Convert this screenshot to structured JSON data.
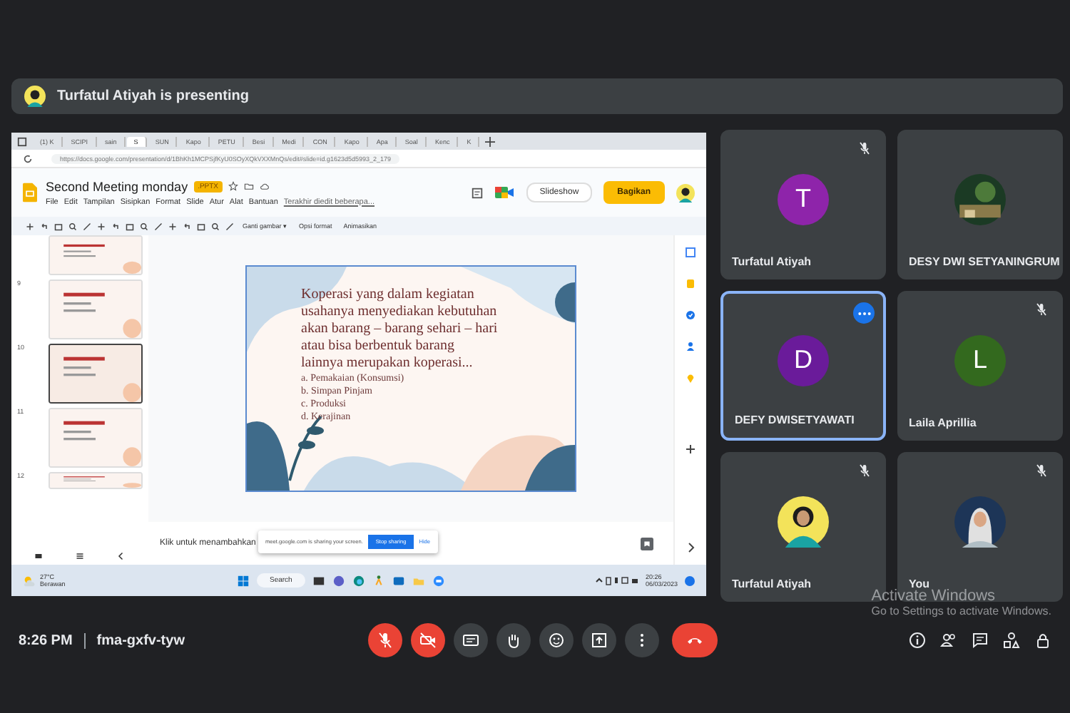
{
  "presenting_banner": {
    "text": "Turfatul Atiyah is presenting"
  },
  "shared_screen": {
    "browser": {
      "tabs": [
        {
          "label": "(1) K",
          "selected": false
        },
        {
          "label": "SCIPI",
          "selected": false
        },
        {
          "label": "sain",
          "selected": false
        },
        {
          "label": "S",
          "selected": true
        },
        {
          "label": "SUN",
          "selected": false
        },
        {
          "label": "Kapo",
          "selected": false
        },
        {
          "label": "PETU",
          "selected": false
        },
        {
          "label": "Besi",
          "selected": false
        },
        {
          "label": "Medi",
          "selected": false
        },
        {
          "label": "CON",
          "selected": false
        },
        {
          "label": "Kapo",
          "selected": false
        },
        {
          "label": "Apa",
          "selected": false
        },
        {
          "label": "Soal",
          "selected": false
        },
        {
          "label": "Kenc",
          "selected": false
        },
        {
          "label": "K",
          "selected": false
        }
      ],
      "url": "https://docs.google.com/presentation/d/1BhKh1MCPSjfKyU0SOyXQkVXXMnQs/edit#slide=id.g1623d5d5993_2_179"
    },
    "slides": {
      "title": "Second Meeting monday",
      "file_badge": ".PPTX",
      "menu": [
        "File",
        "Edit",
        "Tampilan",
        "Sisipkan",
        "Format",
        "Slide",
        "Atur",
        "Alat",
        "Bantuan"
      ],
      "last_edit": "Terakhir diedit beberapa...",
      "slideshow_button": "Slideshow",
      "share_button": "Bagikan",
      "toolbar": [
        "Ganti gambar ▾",
        "Opsi format",
        "Animasikan"
      ],
      "thumbnails": [
        {
          "selected": false
        },
        {
          "number": "9",
          "selected": false
        },
        {
          "number": "10",
          "selected": true
        },
        {
          "number": "11",
          "selected": false
        },
        {
          "number": "12",
          "selected": false
        }
      ],
      "slide": {
        "question_lines": [
          "Koperasi yang dalam kegiatan",
          "usahanya menyediakan kebutuhan",
          "akan barang – barang sehari – hari",
          "atau bisa berbentuk barang",
          "lainnya merupakan koperasi..."
        ],
        "options": [
          "a. Pemakaian (Konsumsi)",
          "b. Simpan Pinjam",
          "c. Produksi",
          "d. Kerajinan"
        ]
      },
      "notes_placeholder": "Klik untuk menambahkan"
    },
    "share_notice": {
      "text": "meet.google.com is sharing your screen.",
      "stop_button": "Stop sharing",
      "hide_button": "Hide"
    },
    "taskbar": {
      "weather_temp": "27°C",
      "weather_text": "Berawan",
      "search": "Search",
      "time": "20:26",
      "date": "06/03/2023"
    }
  },
  "participants": [
    {
      "name": "Turfatul Atiyah",
      "kind": "letter",
      "letter": "T",
      "color": "#8e24aa",
      "muted": true,
      "highlighted": false
    },
    {
      "name": "DESY DWI SETYANINGRUM",
      "kind": "picture",
      "muted": false,
      "highlighted": false
    },
    {
      "name": "DEFY DWISETYAWATI",
      "kind": "letter",
      "letter": "D",
      "color": "#6a1b9a",
      "muted": false,
      "highlighted": true
    },
    {
      "name": "Laila Aprillia",
      "kind": "letter",
      "letter": "L",
      "color": "#33691e",
      "muted": true,
      "highlighted": false
    },
    {
      "name": "Turfatul Atiyah",
      "kind": "picture",
      "muted": true,
      "highlighted": false
    },
    {
      "name": "You",
      "kind": "picture",
      "muted": true,
      "highlighted": false
    }
  ],
  "meeting": {
    "time": "8:26 PM",
    "code": "fma-gxfv-tyw"
  },
  "controls": [
    {
      "kind": "mic",
      "alert": true
    },
    {
      "kind": "camera",
      "alert": true
    },
    {
      "kind": "captions",
      "alert": false
    },
    {
      "kind": "hand",
      "alert": false
    },
    {
      "kind": "emoji",
      "alert": false
    },
    {
      "kind": "present",
      "alert": false
    },
    {
      "kind": "more",
      "alert": false
    },
    {
      "kind": "end",
      "alert": true
    }
  ],
  "side_buttons": [
    {
      "kind": "info"
    },
    {
      "kind": "people"
    },
    {
      "kind": "chat"
    },
    {
      "kind": "activities"
    },
    {
      "kind": "lock"
    }
  ],
  "activation_notice": {
    "title": "Activate Windows",
    "text": "Go to Settings to activate Windows."
  }
}
